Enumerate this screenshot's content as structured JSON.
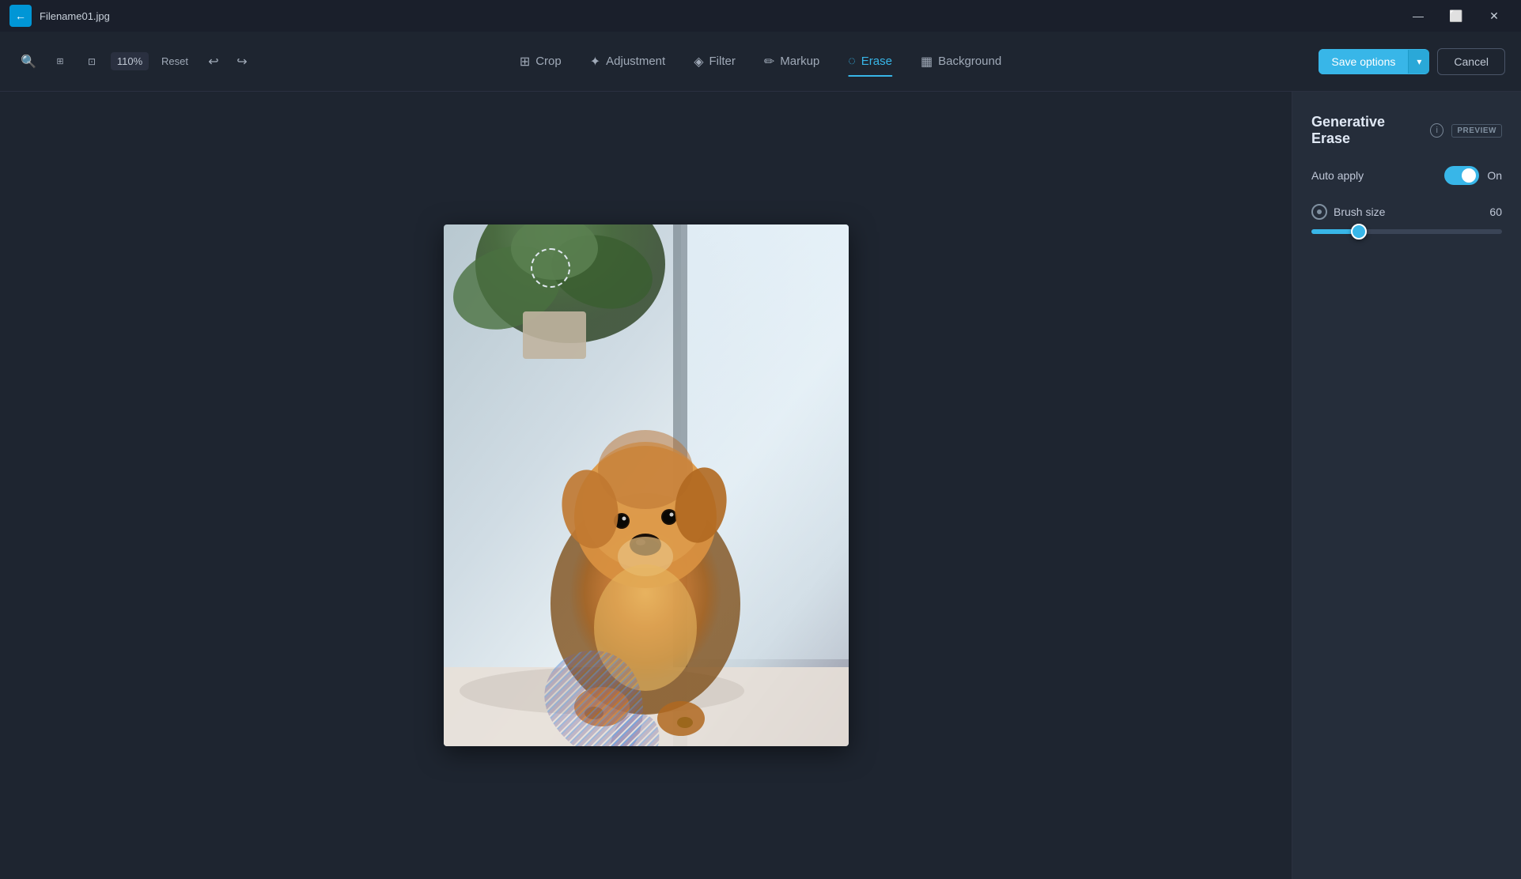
{
  "titlebar": {
    "filename": "Filename01.jpg",
    "back_label": "←",
    "min_label": "—",
    "max_label": "⬜",
    "close_label": "✕"
  },
  "toolbar": {
    "zoom_label": "110%",
    "reset_label": "Reset",
    "undo_label": "↩",
    "redo_label": "↪",
    "tabs": [
      {
        "id": "crop",
        "label": "Crop",
        "icon": "⊞"
      },
      {
        "id": "adjustment",
        "label": "Adjustment",
        "icon": "☀"
      },
      {
        "id": "filter",
        "label": "Filter",
        "icon": "⧫"
      },
      {
        "id": "markup",
        "label": "Markup",
        "icon": "✏"
      },
      {
        "id": "erase",
        "label": "Erase",
        "icon": "◌"
      },
      {
        "id": "background",
        "label": "Background",
        "icon": "▦"
      }
    ],
    "save_options_label": "Save options",
    "cancel_label": "Cancel"
  },
  "panel": {
    "title": "Generative Erase",
    "preview_badge": "PREVIEW",
    "info_tooltip": "i",
    "auto_apply_label": "Auto apply",
    "toggle_state": "On",
    "brush_size_label": "Brush size",
    "brush_size_value": "60",
    "slider_percent": 25
  }
}
